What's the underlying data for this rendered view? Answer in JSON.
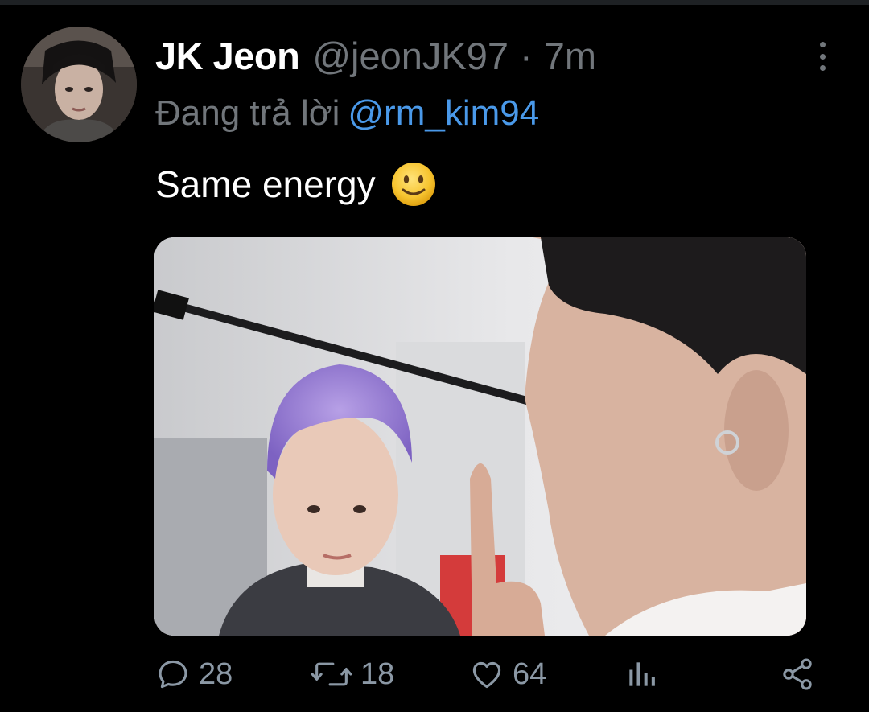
{
  "tweet": {
    "display_name": "JK Jeon",
    "handle": "@jeonJK97",
    "separator": "·",
    "time": "7m",
    "reply_prefix": "Đang trả lời",
    "reply_to": "@rm_kim94",
    "text": "Same energy",
    "emoji": "slightly-smiling-face"
  },
  "actions": {
    "reply_count": "28",
    "retweet_count": "18",
    "like_count": "64"
  },
  "icons": {
    "more": "more-vertical-icon",
    "reply": "reply-icon",
    "retweet": "retweet-icon",
    "like": "heart-icon",
    "views": "views-icon",
    "share": "share-icon"
  },
  "colors": {
    "background": "#000000",
    "text_primary": "#ffffff",
    "text_secondary": "#71767b",
    "link": "#4a99e9",
    "action_gray": "#8b98a5"
  }
}
